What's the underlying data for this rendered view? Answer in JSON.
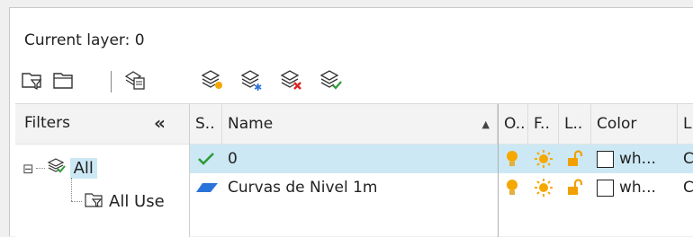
{
  "header": {
    "current_layer_label": "Current layer: 0"
  },
  "toolbar": {
    "left_icons": [
      "new-property-filter-icon",
      "new-group-filter-icon",
      "layer-states-manager-icon"
    ],
    "right_icons": [
      "new-layer-icon",
      "new-layer-vp-frozen-icon",
      "delete-layer-icon",
      "set-current-icon"
    ]
  },
  "filters": {
    "title": "Filters",
    "collapse_glyph": "«",
    "tree": [
      {
        "label": "All",
        "expander": "⊟",
        "selected": true
      },
      {
        "label": "All Use",
        "selected": false
      }
    ]
  },
  "table": {
    "columns": {
      "status": "S..",
      "name": "Name",
      "sort_glyph": "▲",
      "on": "O..",
      "freeze": "F..",
      "lock": "L..",
      "color": "Color",
      "extra": "L"
    },
    "rows": [
      {
        "status_icon": "checkmark-icon",
        "name": "0",
        "color_name": "wh...",
        "extra": "C",
        "selected": true
      },
      {
        "status_icon": "layer-icon",
        "name": "Curvas de Nivel 1m",
        "color_name": "wh...",
        "extra": "C",
        "selected": false
      }
    ]
  },
  "colors": {
    "selection": "#cce8f4",
    "check": "#2e9b3a",
    "bulb": "#f5a800",
    "lock": "#f0a000",
    "layer_blue": "#2a73d9"
  }
}
